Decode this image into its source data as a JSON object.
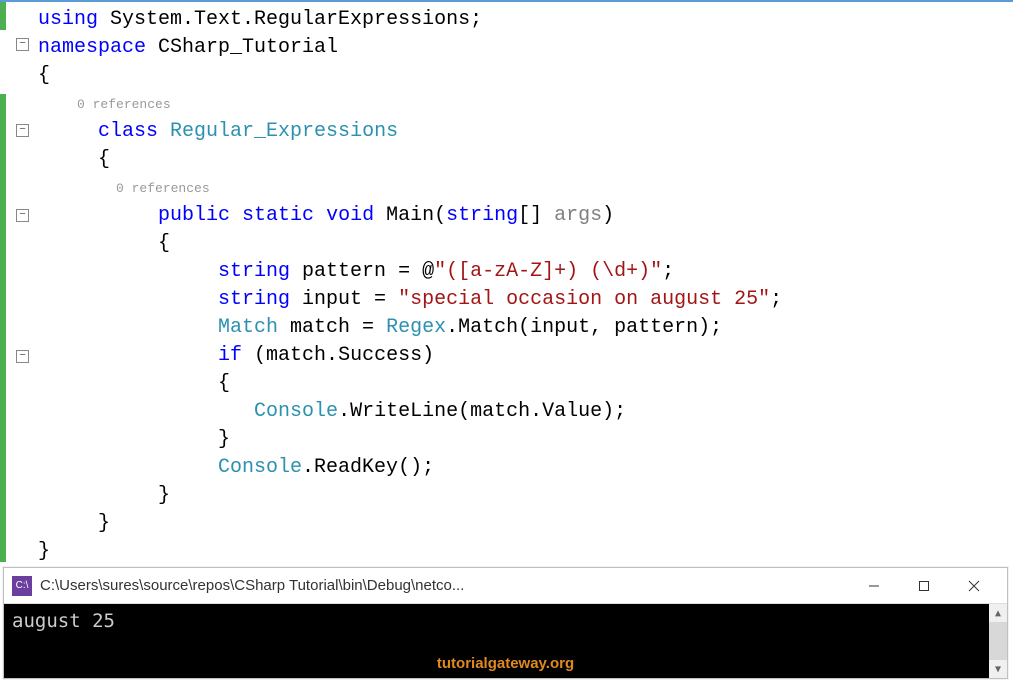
{
  "code": {
    "line1_using": "using",
    "line1_ns": " System.Text.RegularExpressions;",
    "line2_namespace": "namespace",
    "line2_name": " CSharp_Tutorial",
    "brace_open": "{",
    "codelens_class": "0 references",
    "class_kw": "class",
    "class_name": " Regular_Expressions",
    "codelens_method": "0 references",
    "public_kw": "public",
    "static_kw": " static",
    "void_kw": " void",
    "main_name": " Main(",
    "string_kw": "string",
    "args_brackets": "[] ",
    "args_name": "args",
    "close_paren": ")",
    "string_kw2": "string",
    "pattern_decl": " pattern = ",
    "at_sign": "@",
    "pattern_str": "\"([a-zA-Z]+) (\\d+)\"",
    "semicolon": ";",
    "string_kw3": "string",
    "input_decl": " input = ",
    "input_str": "\"special occasion on august 25\"",
    "match_type": "Match",
    "match_decl": " match = ",
    "regex_type": "Regex",
    "match_call": ".Match(input, pattern);",
    "if_kw": "if",
    "if_cond": " (match.Success)",
    "console_type": "Console",
    "writeline": ".WriteLine(match.Value);",
    "console_type2": "Console",
    "readkey": ".ReadKey();",
    "brace_close": "}"
  },
  "console": {
    "icon_text": "C:\\",
    "title": "C:\\Users\\sures\\source\\repos\\CSharp Tutorial\\bin\\Debug\\netco...",
    "output": "august 25",
    "watermark": "tutorialgateway.org"
  }
}
